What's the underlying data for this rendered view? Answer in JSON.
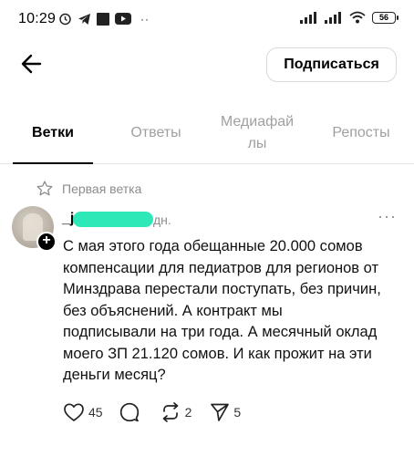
{
  "status_bar": {
    "time": "10:29",
    "battery": "56",
    "icons": [
      "alarm-icon",
      "telegram-icon",
      "app-icon",
      "youtube-icon",
      "more-dots-icon",
      "signal-icon",
      "signal-icon",
      "wifi-icon",
      "battery-icon"
    ]
  },
  "header": {
    "back_icon": "arrow-left-icon",
    "subscribe_label": "Подписаться"
  },
  "tabs": [
    {
      "label": "Ветки",
      "active": true
    },
    {
      "label": "Ответы",
      "active": false
    },
    {
      "label": "Медиафай\nлы",
      "active": false
    },
    {
      "label": "Репосты",
      "active": false
    }
  ],
  "post": {
    "pinned_label": "Первая ветка",
    "username_prefix": "_j",
    "time_suffix": "дн.",
    "more": "···",
    "text": "С мая этого года обещанные 20.000 сомов\nкомпенсации для педиатров для регионов от\nМинздрава перестали поступать, без причин,\nбез объяснений. А контракт мы\nподписывали на три года. А месячный оклад\nмоего ЗП  21.120 сомов. И как прожит на эти\nденьги месяц?",
    "likes": "45",
    "reposts": "2",
    "shares": "5"
  },
  "colors": {
    "redaction": "#2ee8b8",
    "muted": "#8c8c8c"
  }
}
